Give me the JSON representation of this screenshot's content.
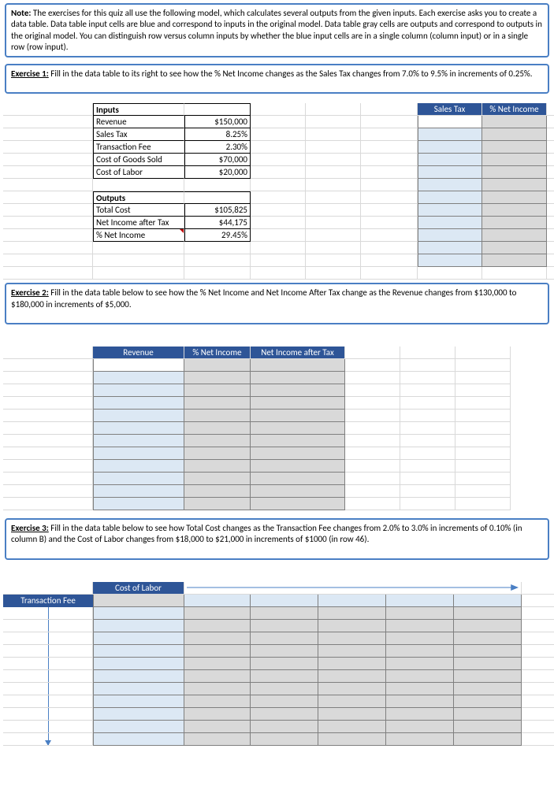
{
  "note": {
    "title": "Note:",
    "body": " The exercises for this quiz all use the following model, which calculates several outputs from the given inputs. Each exercise asks you to create a data table. Data table input cells are blue and correspond to inputs in the original model. Data table gray cells are outputs and correspond to outputs in the original model. You can distinguish row versus column inputs by whether the blue input cells are in a single column (column input) or in a single row (row input)."
  },
  "ex1": {
    "title": "Exercise 1:",
    "body": " Fill in the data table to its right to see how the % Net Income changes as the Sales Tax changes from 7.0% to 9.5%  in increments of 0.25%."
  },
  "inputsHeader": "Inputs",
  "outputsHeader": "Outputs",
  "inputs": {
    "revenue_label": "Revenue",
    "revenue_val": "$150,000",
    "salestax_label": "Sales Tax",
    "salestax_val": "8.25%",
    "transfee_label": "Transaction Fee",
    "transfee_val": "2.30%",
    "cogs_label": "Cost of Goods Sold",
    "cogs_val": "$70,000",
    "labor_label": "Cost of Labor",
    "labor_val": "$20,000"
  },
  "outputs": {
    "total_label": "Total Cost",
    "total_val": "$105,825",
    "net_label": "Net Income after Tax",
    "net_val": "$44,175",
    "pct_label": "% Net Income",
    "pct_val": "29.45%"
  },
  "dt1": {
    "h1": "Sales Tax",
    "h2": "% Net Income"
  },
  "ex2": {
    "title": "Exercise 2:",
    "body": " Fill in the data table below to see how the % Net Income and Net Income After Tax change as the Revenue changes from $130,000 to $180,000 in increments of $5,000."
  },
  "dt2": {
    "h1": "Revenue",
    "h2": "% Net Income",
    "h3": "Net Income after Tax"
  },
  "ex3": {
    "title": "Exercise 3:",
    "body": " Fill in the data table below to see how Total Cost changes as the Transaction Fee changes from 2.0% to 3.0% in increments of 0.10% (in column B) and the Cost of Labor changes from $18,000 to $21,000 in increments of $1000 (in row 46)."
  },
  "dt3": {
    "rowlabel": "Cost of Labor",
    "collabel": "Transaction Fee"
  }
}
